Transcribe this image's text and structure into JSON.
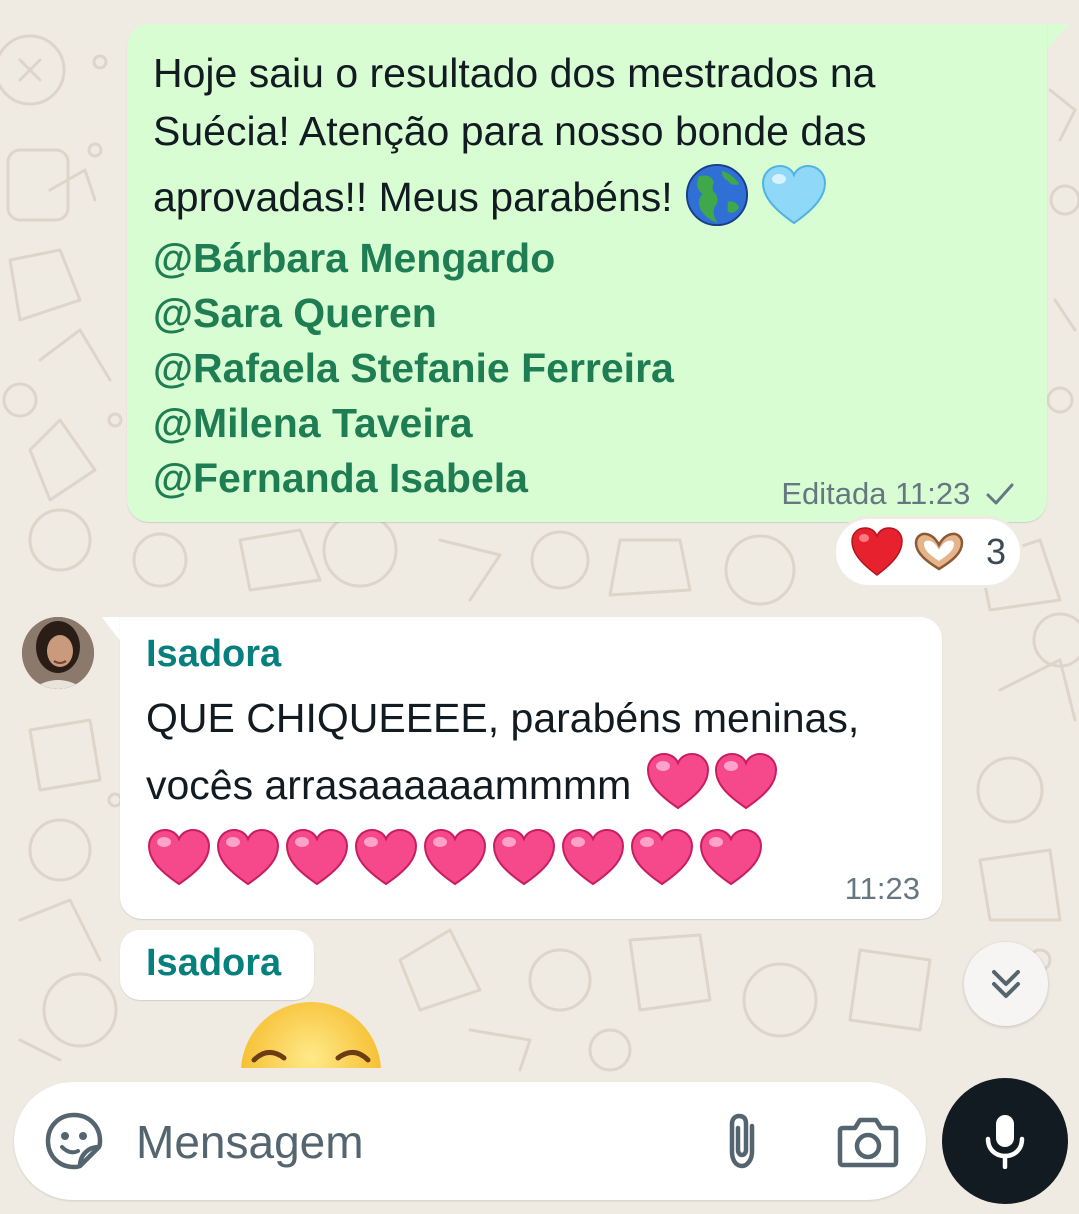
{
  "colors": {
    "wallpaper": "#efeae2",
    "outgoing_bubble": "#d9fdd3",
    "incoming_bubble": "#ffffff",
    "mention": "#1f7d53",
    "sender_name": "#06807d",
    "meta_text": "#667781",
    "mic_button": "#111b21"
  },
  "outgoing": {
    "text_lines": [
      "Hoje saiu o resultado dos mestrados na",
      "Suécia! Atenção para nosso bonde das",
      "aprovadas!! Meus parabéns!"
    ],
    "inline_emojis": [
      "globe-americas-icon",
      "light-blue-heart-icon"
    ],
    "mentions": [
      "@Bárbara Mengardo",
      "@Sara Queren",
      "@Rafaela Stefanie Ferreira",
      "@Milena Taveira",
      "@Fernanda Isabela"
    ],
    "edited_label": "Editada",
    "time": "11:23",
    "status_icon": "single-check-icon"
  },
  "reactions": {
    "emojis": [
      "red-heart-icon",
      "heart-hands-icon"
    ],
    "count": "3"
  },
  "incoming": {
    "sender": "Isadora",
    "text_lines": [
      "QUE CHIQUEEEE, parabéns meninas,",
      "vocês arrasaaaaaammmm"
    ],
    "pink_hearts_inline": 2,
    "pink_hearts_row": 9,
    "time": "11:23"
  },
  "incoming_2": {
    "sender": "Isadora",
    "partial_emoji": "relieved-face-icon"
  },
  "composer": {
    "placeholder": "Mensagem",
    "sticker_icon": "sticker-icon",
    "attach_icon": "paperclip-icon",
    "camera_icon": "camera-icon",
    "mic_icon": "microphone-icon"
  },
  "scroll_button_icon": "double-chevron-down-icon"
}
